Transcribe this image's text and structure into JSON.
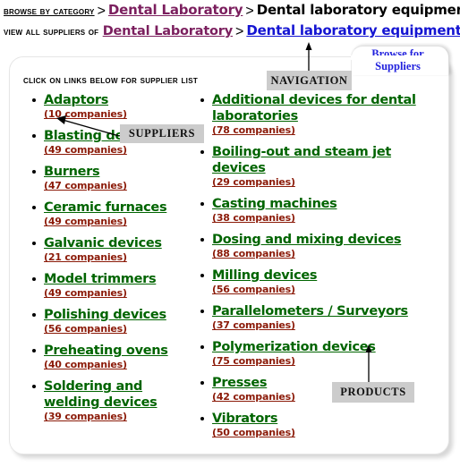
{
  "breadcrumbs": {
    "row1": {
      "label": "Browse by category",
      "separator1": ">",
      "link1": "Dental Laboratory",
      "separator2": ">",
      "current": "Dental laboratory equipment"
    },
    "row2": {
      "label": "View all suppliers of",
      "link1": "Dental Laboratory",
      "separator": ">",
      "link2": "Dental laboratory equipment"
    }
  },
  "tab": {
    "line1": "Browse for",
    "line2": "Suppliers"
  },
  "panel": {
    "title": "Click on links below for supplier list"
  },
  "annotations": [
    {
      "id": "navigation",
      "label": "NAVIGATION"
    },
    {
      "id": "suppliers",
      "label": "SUPPLIERS"
    },
    {
      "id": "products",
      "label": "PRODUCTS"
    }
  ],
  "categories": {
    "left": [
      {
        "name": "Adaptors",
        "count": "(10 companies)"
      },
      {
        "name": "Blasting devices",
        "count": "(49 companies)"
      },
      {
        "name": "Burners",
        "count": "(47 companies)"
      },
      {
        "name": "Ceramic furnaces",
        "count": "(49 companies)"
      },
      {
        "name": "Galvanic devices",
        "count": "(21 companies)"
      },
      {
        "name": "Model trimmers",
        "count": "(49 companies)"
      },
      {
        "name": "Polishing devices",
        "count": "(56 companies)"
      },
      {
        "name": "Preheating ovens",
        "count": "(40 companies)"
      },
      {
        "name": "Soldering and welding devices",
        "count": "(39 companies)"
      }
    ],
    "right": [
      {
        "name": "Additional devices for dental laboratories",
        "count": "(78 companies)"
      },
      {
        "name": "Boiling-out and steam jet devices",
        "count": "(29 companies)"
      },
      {
        "name": "Casting machines",
        "count": "(38 companies)"
      },
      {
        "name": "Dosing and mixing devices",
        "count": "(88 companies)"
      },
      {
        "name": "Milling devices",
        "count": "(56 companies)"
      },
      {
        "name": "Parallelometers / Surveyors",
        "count": "(37 companies)"
      },
      {
        "name": "Polymerization devices",
        "count": "(75 companies)"
      },
      {
        "name": "Presses",
        "count": "(42 companies)"
      },
      {
        "name": "Vibrators",
        "count": "(50 companies)"
      }
    ]
  },
  "colors": {
    "category_link": "#006400",
    "company_count": "#8b1a08",
    "breadcrumb_link": "#7b1f5e",
    "breadcrumb_current_link": "#1414d2",
    "tab_text": "#2222dd",
    "callout_bg": "#cccccc"
  }
}
